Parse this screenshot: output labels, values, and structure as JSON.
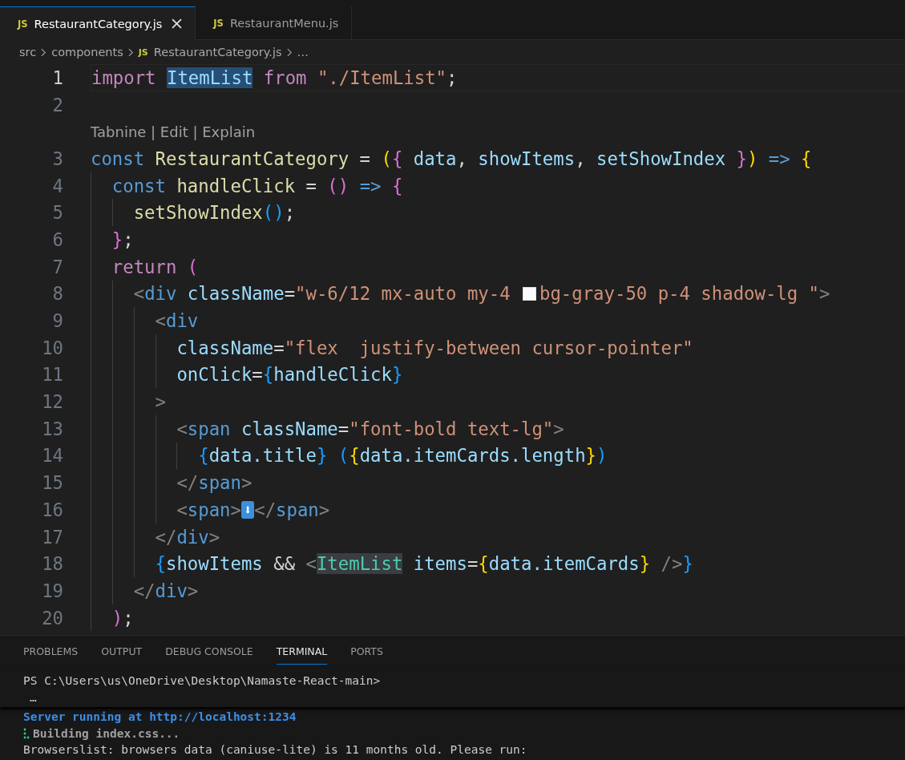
{
  "tabs": [
    {
      "label": "RestaurantCategory.js",
      "selected": true,
      "badge": "JS"
    },
    {
      "label": "RestaurantMenu.js",
      "selected": false,
      "badge": "JS"
    }
  ],
  "breadcrumbs": [
    {
      "label": "src"
    },
    {
      "label": "components"
    },
    {
      "label": "RestaurantCategory.js",
      "badge": "JS"
    },
    {
      "label": "…"
    }
  ],
  "editor": {
    "lines": [
      {
        "number": "1",
        "current": true,
        "tokens": [
          {
            "t": "import ",
            "kind": "kw"
          },
          {
            "t": "ItemList",
            "kind": "selection"
          },
          {
            "t": " from ",
            "kind": "kw"
          },
          {
            "t": "\"./ItemList\"",
            "kind": "str"
          },
          {
            "t": ";",
            "kind": "p"
          }
        ]
      },
      {
        "number": "2",
        "current": false
      },
      {
        "number": "3",
        "current": false,
        "codelens": "Tabnine | Edit | Explain",
        "tokens": [
          {
            "t": "const ",
            "kind": "st"
          },
          {
            "t": "RestaurantCategory",
            "kind": "fn"
          },
          {
            "t": " = ",
            "kind": "p"
          },
          {
            "t": "(",
            "kind": "br1"
          },
          {
            "t": "{ ",
            "kind": "br2"
          },
          {
            "t": "data",
            "kind": "var"
          },
          {
            "t": ", ",
            "kind": "p"
          },
          {
            "t": "showItems",
            "kind": "var"
          },
          {
            "t": ", ",
            "kind": "p"
          },
          {
            "t": "setShowIndex ",
            "kind": "var"
          },
          {
            "t": "}",
            "kind": "br2"
          },
          {
            "t": ") ",
            "kind": "br1"
          },
          {
            "t": "=> ",
            "kind": "st"
          },
          {
            "t": "{",
            "kind": "br1"
          }
        ]
      },
      {
        "number": "4",
        "current": false,
        "tokens": [
          {
            "t": "  const ",
            "kind": "st"
          },
          {
            "t": "handleClick",
            "kind": "fn"
          },
          {
            "t": " = ",
            "kind": "p"
          },
          {
            "t": "() ",
            "kind": "br2"
          },
          {
            "t": "=> ",
            "kind": "st"
          },
          {
            "t": "{",
            "kind": "br2"
          }
        ]
      },
      {
        "number": "5",
        "current": false,
        "tokens": [
          {
            "t": "    setShowIndex",
            "kind": "fn"
          },
          {
            "t": "()",
            "kind": "br3"
          },
          {
            "t": ";",
            "kind": "p"
          }
        ]
      },
      {
        "number": "6",
        "current": false,
        "tokens": [
          {
            "t": "  }",
            "kind": "br2"
          },
          {
            "t": ";",
            "kind": "p"
          }
        ]
      },
      {
        "number": "7",
        "current": false,
        "tokens": [
          {
            "t": "  return ",
            "kind": "kw"
          },
          {
            "t": "(",
            "kind": "br2"
          }
        ]
      },
      {
        "number": "8",
        "current": false,
        "tokens": [
          {
            "t": "    <",
            "kind": "tag"
          },
          {
            "t": "div ",
            "kind": "tn"
          },
          {
            "t": "className",
            "kind": "attr"
          },
          {
            "t": "=",
            "kind": "p"
          },
          {
            "t": "\"w-6/12 mx-auto my-4 ",
            "kind": "str"
          },
          {
            "kind": "swatch",
            "color": "#f9fafb"
          },
          {
            "t": "bg-gray-50 p-4 shadow-lg \"",
            "kind": "str"
          },
          {
            "t": ">",
            "kind": "tag"
          }
        ]
      },
      {
        "number": "9",
        "current": false,
        "tokens": [
          {
            "t": "      <",
            "kind": "tag"
          },
          {
            "t": "div",
            "kind": "tn"
          }
        ]
      },
      {
        "number": "10",
        "current": false,
        "tokens": [
          {
            "t": "        className",
            "kind": "attr"
          },
          {
            "t": "=",
            "kind": "p"
          },
          {
            "t": "\"flex  justify-between cursor-pointer\"",
            "kind": "str"
          }
        ]
      },
      {
        "number": "11",
        "current": false,
        "tokens": [
          {
            "t": "        onClick",
            "kind": "attr"
          },
          {
            "t": "=",
            "kind": "p"
          },
          {
            "t": "{",
            "kind": "br3"
          },
          {
            "t": "handleClick",
            "kind": "var"
          },
          {
            "t": "}",
            "kind": "br3"
          }
        ]
      },
      {
        "number": "12",
        "current": false,
        "tokens": [
          {
            "t": "      >",
            "kind": "tag"
          }
        ]
      },
      {
        "number": "13",
        "current": false,
        "tokens": [
          {
            "t": "        <",
            "kind": "tag"
          },
          {
            "t": "span ",
            "kind": "tn"
          },
          {
            "t": "className",
            "kind": "attr"
          },
          {
            "t": "=",
            "kind": "p"
          },
          {
            "t": "\"font-bold text-lg\"",
            "kind": "str"
          },
          {
            "t": ">",
            "kind": "tag"
          }
        ]
      },
      {
        "number": "14",
        "current": false,
        "tokens": [
          {
            "t": "          {",
            "kind": "br3"
          },
          {
            "t": "data.title",
            "kind": "var"
          },
          {
            "t": "} ",
            "kind": "br3"
          },
          {
            "t": "(",
            "kind": "br3"
          },
          {
            "t": "{",
            "kind": "br1"
          },
          {
            "t": "data.itemCards.length",
            "kind": "var"
          },
          {
            "t": "}",
            "kind": "br1"
          },
          {
            "t": ")",
            "kind": "br3"
          }
        ]
      },
      {
        "number": "15",
        "current": false,
        "tokens": [
          {
            "t": "        </",
            "kind": "tag"
          },
          {
            "t": "span",
            "kind": "tn"
          },
          {
            "t": ">",
            "kind": "tag"
          }
        ]
      },
      {
        "number": "16",
        "current": false,
        "tokens": [
          {
            "t": "        <",
            "kind": "tag"
          },
          {
            "t": "span",
            "kind": "tn"
          },
          {
            "t": ">",
            "kind": "tag"
          },
          {
            "t": "⬇",
            "kind": "emoji"
          },
          {
            "t": "</",
            "kind": "tag"
          },
          {
            "t": "span",
            "kind": "tn"
          },
          {
            "t": ">",
            "kind": "tag"
          }
        ]
      },
      {
        "number": "17",
        "current": false,
        "tokens": [
          {
            "t": "      </",
            "kind": "tag"
          },
          {
            "t": "div",
            "kind": "tn"
          },
          {
            "t": ">",
            "kind": "tag"
          }
        ]
      },
      {
        "number": "18",
        "current": false,
        "tokens": [
          {
            "t": "      {",
            "kind": "br3"
          },
          {
            "t": "showItems",
            "kind": "var"
          },
          {
            "t": " && ",
            "kind": "p"
          },
          {
            "t": "<",
            "kind": "tag"
          },
          {
            "t": "ItemList",
            "kind": "occurrence"
          },
          {
            "t": " items",
            "kind": "attr"
          },
          {
            "t": "=",
            "kind": "p"
          },
          {
            "t": "{",
            "kind": "br1"
          },
          {
            "t": "data.itemCards",
            "kind": "var"
          },
          {
            "t": "}",
            "kind": "br1"
          },
          {
            "t": " />",
            "kind": "tag"
          },
          {
            "t": "}",
            "kind": "br3"
          }
        ]
      },
      {
        "number": "19",
        "current": false,
        "tokens": [
          {
            "t": "    </",
            "kind": "tag"
          },
          {
            "t": "div",
            "kind": "tn"
          },
          {
            "t": ">",
            "kind": "tag"
          }
        ]
      },
      {
        "number": "20",
        "current": false,
        "tokens": [
          {
            "t": "  )",
            "kind": "br2"
          },
          {
            "t": ";",
            "kind": "p"
          }
        ]
      }
    ]
  },
  "panel": {
    "tabs": [
      {
        "label": "PROBLEMS",
        "selected": false
      },
      {
        "label": "OUTPUT",
        "selected": false
      },
      {
        "label": "DEBUG CONSOLE",
        "selected": false
      },
      {
        "label": "TERMINAL",
        "selected": true
      },
      {
        "label": "PORTS",
        "selected": false
      }
    ],
    "sticky": [
      {
        "kind": "prompt",
        "text": "PS C:\\Users\\us\\OneDrive\\Desktop\\Namaste-React-main>"
      },
      {
        "kind": "ellipsis",
        "text": "…"
      }
    ],
    "output": [
      {
        "kind": "info",
        "text": "Server running at http://localhost:1234"
      },
      {
        "kind": "progress",
        "text": "Building index.css..."
      },
      {
        "kind": "plain",
        "text": "Browserslist: browsers data (caniuse-lite) is 11 months old. Please run:"
      }
    ]
  }
}
